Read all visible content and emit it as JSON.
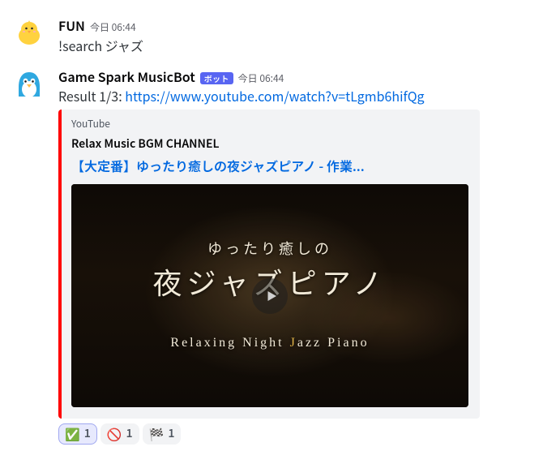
{
  "messages": {
    "user": {
      "username": "FUN",
      "timestamp": "今日 06:44",
      "content": "!search ジャズ"
    },
    "bot": {
      "username": "Game Spark MusicBot",
      "bot_tag": "ボット",
      "timestamp": "今日 06:44",
      "result_prefix": "Result 1/3: ",
      "result_url": "https://www.youtube.com/watch?v=tLgmb6hifQg",
      "embed": {
        "provider": "YouTube",
        "author": "Relax Music BGM CHANNEL",
        "title": "【大定番】ゆったり癒しの夜ジャズピアノ - 作業...",
        "thumb": {
          "line1": "ゆったり癒しの",
          "line2": "夜ジャズピアノ",
          "line3_pre": "Relaxing  Night ",
          "line3_j": "J",
          "line3_post": "azz  Piano"
        }
      },
      "reactions": [
        {
          "emoji": "✅",
          "count": "1",
          "me": true
        },
        {
          "emoji": "🚫",
          "count": "1",
          "me": false
        },
        {
          "emoji": "🏁",
          "count": "1",
          "me": false
        }
      ]
    }
  }
}
